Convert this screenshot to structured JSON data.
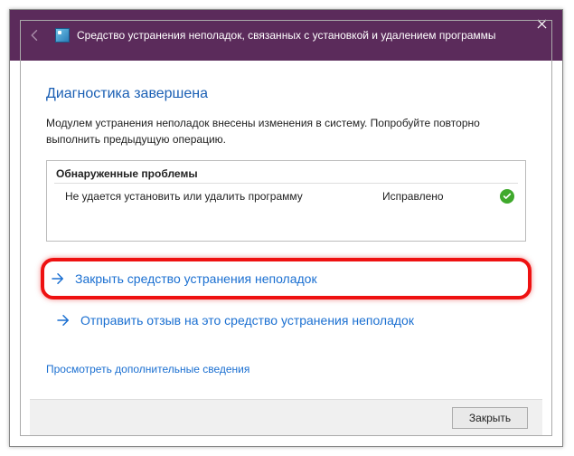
{
  "titlebar": {
    "title": "Средство устранения неполадок, связанных с установкой и удалением программы"
  },
  "heading": "Диагностика завершена",
  "subtext": "Модулем устранения неполадок внесены изменения в систему. Попробуйте повторно выполнить предыдущую операцию.",
  "problems": {
    "header": "Обнаруженные проблемы",
    "items": [
      {
        "desc": "Не удается установить или удалить программу",
        "status": "Исправлено",
        "ok": true
      }
    ]
  },
  "actions": {
    "close": "Закрыть средство устранения неполадок",
    "feedback": "Отправить отзыв на это средство устранения неполадок"
  },
  "extra_link": "Просмотреть дополнительные сведения",
  "footer": {
    "close": "Закрыть"
  }
}
